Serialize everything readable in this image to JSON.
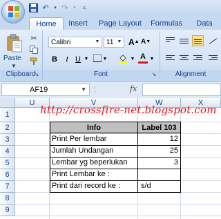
{
  "qat": {
    "icons": [
      "save-icon",
      "undo-icon",
      "redo-icon"
    ]
  },
  "tabs": [
    "Home",
    "Insert",
    "Page Layout",
    "Formulas",
    "Data"
  ],
  "clipboard": {
    "paste_label": "Paste",
    "group_label": "Clipboard"
  },
  "font": {
    "name": "Calibri",
    "size": "11",
    "group_label": "Font",
    "bold": "B",
    "italic": "I",
    "underline": "U",
    "grow": "A",
    "shrink": "A",
    "font_color_label": "A"
  },
  "alignment": {
    "group_label": "Alignment"
  },
  "formula_bar": {
    "name_box": "AF19",
    "fx": "fx",
    "formula": ""
  },
  "columns": [
    "U",
    "V",
    "W",
    "X"
  ],
  "rows": [
    "1",
    "2",
    "3",
    "4",
    "5",
    "6",
    "7",
    "8",
    "9"
  ],
  "watermark": "http://crossfire-net.blogspot.com",
  "table": {
    "header": {
      "info": "Info",
      "label": "Label 103"
    },
    "rows": [
      {
        "info": "Print Per lembar",
        "value": "12"
      },
      {
        "info": "Jumlah Undangan",
        "value": "25"
      },
      {
        "info": "Lembar yg beperlukan",
        "value": "3"
      },
      {
        "info": "Print Lembar ke :",
        "value": ""
      },
      {
        "info": "Print dari record ke :",
        "value": "s/d"
      }
    ]
  },
  "colors": {
    "accent": "#15428b",
    "header_fill": "#c0c0c0",
    "watermark": "#e0121a"
  }
}
